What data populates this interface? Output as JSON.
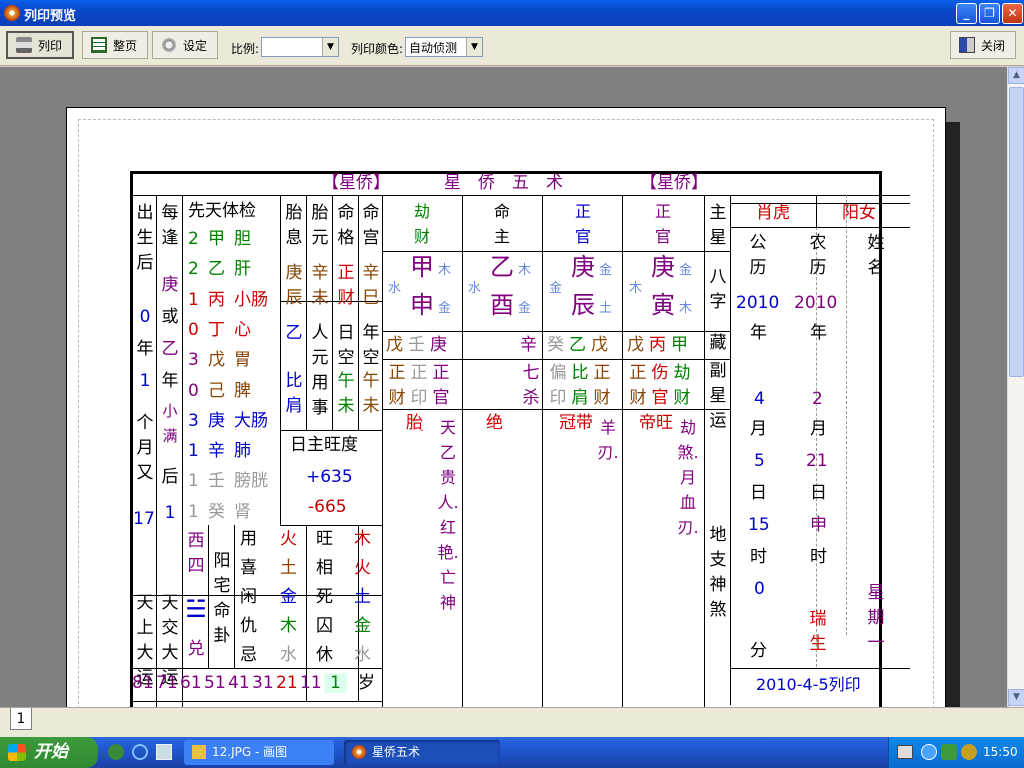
{
  "window": {
    "title": "列印预览"
  },
  "toolbar": {
    "print": "列印",
    "whole_page": "整页",
    "settings": "设定",
    "scale_label": "比例:",
    "scale_value": "",
    "color_label": "列印颜色:",
    "color_value": "自动侦测",
    "close": "关闭"
  },
  "chart": {
    "header_left": "【星侨】",
    "header_mid": "星　侨　五　术",
    "header_right": "【星侨】",
    "col_born": "出生后",
    "col_every": "每逢",
    "col_health": "先天体检",
    "col_tai_xi": "胎息",
    "col_tai_yuan": "胎元",
    "col_ming_ge": "命格",
    "col_ming_gong": "命宫",
    "col_zhuxing": "主星",
    "zodiac": "肖虎",
    "gender": "阳女",
    "name_label": "姓名",
    "born_0": "0",
    "born_nian": "年",
    "born_1": "1",
    "born_month": "个月又",
    "born_17": "17",
    "every_geng": "庚",
    "every_huo": "或",
    "every_yi": "乙",
    "every_nian": "年",
    "every_xiaoman": "小满",
    "every_hou": "后",
    "every_1": "1",
    "health": [
      {
        "n": "2",
        "s": "甲",
        "o": "胆"
      },
      {
        "n": "2",
        "s": "乙",
        "o": "肝"
      },
      {
        "n": "1",
        "s": "丙",
        "o": "小肠"
      },
      {
        "n": "0",
        "s": "丁",
        "o": "心"
      },
      {
        "n": "3",
        "s": "戊",
        "o": "胃"
      },
      {
        "n": "0",
        "s": "己",
        "o": "脾"
      },
      {
        "n": "3",
        "s": "庚",
        "o": "大肠"
      },
      {
        "n": "1",
        "s": "辛",
        "o": "肺"
      },
      {
        "n": "1",
        "s": "壬",
        "o": "膀胱"
      },
      {
        "n": "1",
        "s": "癸",
        "o": "肾"
      }
    ],
    "taixi": "庚辰",
    "taiyuan": "辛未",
    "mingge": "正财",
    "minggong": "辛巳",
    "yi_biJian": "乙",
    "bijian": "比肩",
    "yuanyongshi": "人元用事",
    "rikong": "日空",
    "wuwei1": "午未",
    "niankong": "年空",
    "wuwei2": "午未",
    "rizhu_label": "日主旺度",
    "score_pos": "+635",
    "score_neg": "-665",
    "pillars": [
      {
        "god": "劫财",
        "stem": "甲",
        "branch": "申",
        "stem_el": "木",
        "br_el": "金",
        "pre_el": "水"
      },
      {
        "god": "命主",
        "stem": "乙",
        "branch": "酉",
        "stem_el": "木",
        "br_el": "金",
        "pre_el": "水"
      },
      {
        "god": "正官",
        "stem": "庚",
        "branch": "辰",
        "stem_el": "金",
        "br_el": "土",
        "pre_el": "金"
      },
      {
        "god": "正官",
        "stem": "庚",
        "branch": "寅",
        "stem_el": "金",
        "br_el": "木",
        "pre_el": "木"
      }
    ],
    "bazi_label": "八字",
    "cang_label": "藏",
    "fuxing_label": "副星",
    "yun_label": "运",
    "hidden": [
      [
        "戊",
        "壬",
        "庚"
      ],
      [
        "辛"
      ],
      [
        "癸",
        "乙",
        "戊"
      ],
      [
        "戊",
        "丙",
        "甲"
      ]
    ],
    "fuxing": [
      [
        "正财",
        "正印",
        "正官"
      ],
      [
        "七杀"
      ],
      [
        "偏印",
        "比肩",
        "正财"
      ],
      [
        "正财",
        "伤官",
        "劫财"
      ]
    ],
    "yun": [
      "胎",
      "绝",
      "冠带",
      "帝旺"
    ],
    "shensha1": "天乙贵人.红艳.亡神",
    "shensha3": "羊刃.",
    "shensha4": "劫煞.月血刃.",
    "dizhi_label": "地支神煞",
    "gongli": "公历",
    "nongli": "农历",
    "g_year": "2010",
    "n_year": "2010",
    "nian": "年",
    "g_month": "4",
    "n_month": "2",
    "yue": "月",
    "g_day": "5",
    "n_day": "21",
    "ri": "日",
    "g_hour": "15",
    "n_hour": "申",
    "shi": "时",
    "g_min": "0",
    "fen": "分",
    "ruisheng": "瑞生",
    "xingqi": "星期一",
    "print_date": "2010-4-5列印",
    "xisi": "西四",
    "kun_symbol": "☱",
    "dui": "兑",
    "yangzhai": "阳宅命卦",
    "yong_rows": [
      "用",
      "喜",
      "闲",
      "仇",
      "忌"
    ],
    "yong_el": [
      "火",
      "土",
      "金",
      "木",
      "水"
    ],
    "wang_rows": [
      "旺",
      "相",
      "死",
      "囚",
      "休"
    ],
    "wang_el": [
      "木",
      "火",
      "土",
      "金",
      "水"
    ],
    "tian_dayun": "天上大运",
    "tian_jiao": "天交大运",
    "ages": [
      "81",
      "71",
      "61",
      "51",
      "41",
      "31",
      "21",
      "11",
      "1"
    ],
    "sui": "岁"
  },
  "tab": {
    "label": "1"
  },
  "taskbar": {
    "start": "开始",
    "task1": "12.JPG - 画图",
    "task2": "星侨五术",
    "clock": "15:50"
  },
  "colors": {
    "title_bar": "#0a5fe8",
    "taskbar": "#245edb",
    "start": "#3c9a3c",
    "purple": "#800080",
    "blue": "#0000cc",
    "red": "#cc0000",
    "green": "#008000"
  }
}
